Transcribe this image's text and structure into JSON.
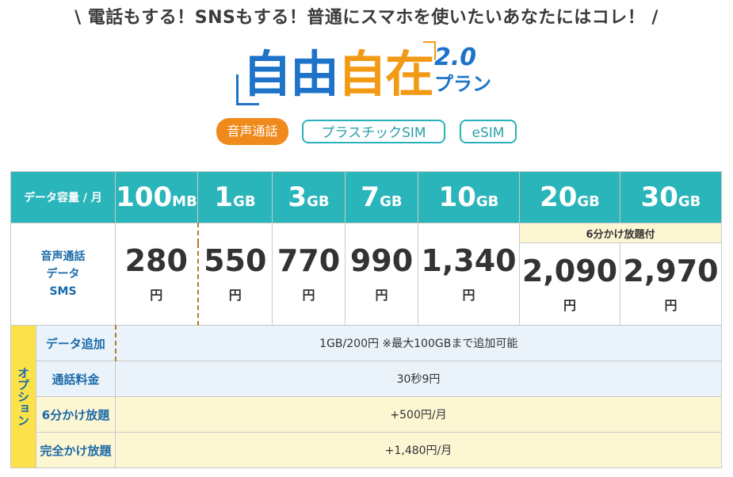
{
  "tagline": "\\ 電話もする！SNSもする！普通にスマホを使いたいあなたにはコレ！ /",
  "logo": {
    "word_a": "自由",
    "word_b": "自在",
    "version": "2.0",
    "plan": "プラン"
  },
  "chips": [
    "音声通話",
    "プラスチックSIM",
    "eSIM"
  ],
  "table": {
    "header_label": "データ容量 / 月",
    "plans": [
      {
        "num": "100",
        "unit": "MB",
        "price": "280"
      },
      {
        "num": "1",
        "unit": "GB",
        "price": "550"
      },
      {
        "num": "3",
        "unit": "GB",
        "price": "770"
      },
      {
        "num": "7",
        "unit": "GB",
        "price": "990"
      },
      {
        "num": "10",
        "unit": "GB",
        "price": "1,340"
      },
      {
        "num": "20",
        "unit": "GB",
        "price": "2,090"
      },
      {
        "num": "30",
        "unit": "GB",
        "price": "2,970"
      }
    ],
    "yen": "円",
    "row_label": [
      "音声通話",
      "データ",
      "SMS"
    ],
    "note": "6分かけ放題付",
    "options_label": "オプション",
    "options": [
      {
        "label": "データ追加",
        "value": "1GB/200円 ※最大100GBまで追加可能"
      },
      {
        "label": "通話料金",
        "value": "30秒9円"
      },
      {
        "label": "6分かけ放題",
        "value": "+500円/月"
      },
      {
        "label": "完全かけ放題",
        "value": "+1,480円/月"
      }
    ]
  },
  "colors": {
    "teal": "#2ab5ba",
    "orange": "#f08a1c",
    "blue": "#1e73c8",
    "yellow": "#fbe24a",
    "option_blue_bg": "#eaf3fa",
    "option_yellow_bg": "#fdf6d3"
  }
}
